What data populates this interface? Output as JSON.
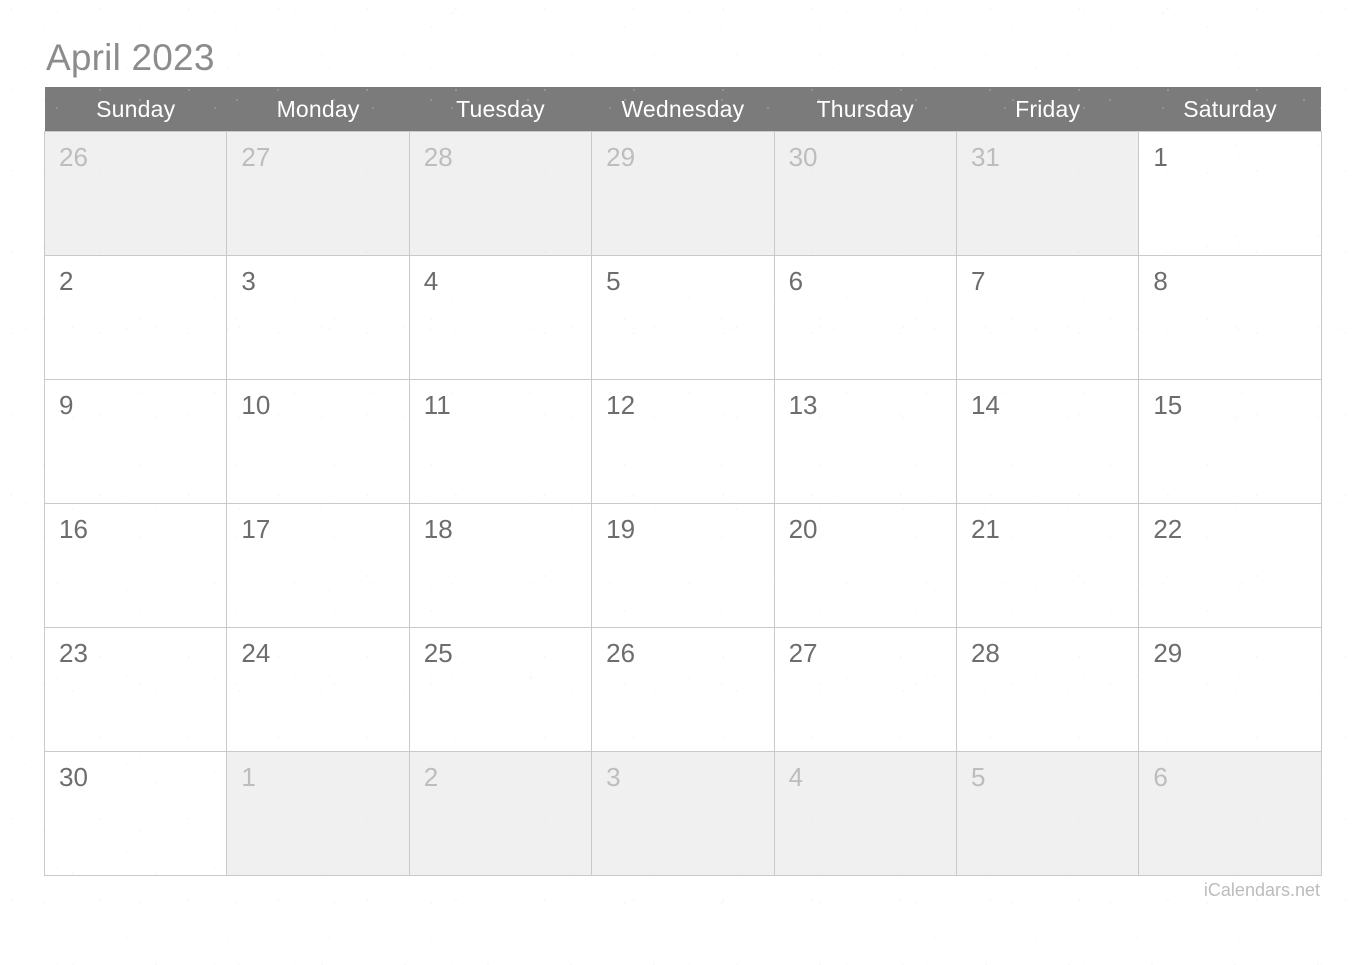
{
  "title": "April 2023",
  "weekday_headers": [
    "Sunday",
    "Monday",
    "Tuesday",
    "Wednesday",
    "Thursday",
    "Friday",
    "Saturday"
  ],
  "watermark": "iCalendars.net",
  "colors": {
    "header_bar": "#7b7b7b",
    "header_text": "#ffffff",
    "title_text": "#8c8c8c",
    "cell_border": "#c9c9c9",
    "cell_background": "#ffffff",
    "padding_cell_background": "#f0f0f0",
    "day_number": "#6d6d6d",
    "padding_day_number": "#bdbdbd",
    "watermark_text": "#bcbcbc"
  },
  "weeks": [
    [
      {
        "day": "26",
        "in_month": false
      },
      {
        "day": "27",
        "in_month": false
      },
      {
        "day": "28",
        "in_month": false
      },
      {
        "day": "29",
        "in_month": false
      },
      {
        "day": "30",
        "in_month": false
      },
      {
        "day": "31",
        "in_month": false
      },
      {
        "day": "1",
        "in_month": true
      }
    ],
    [
      {
        "day": "2",
        "in_month": true
      },
      {
        "day": "3",
        "in_month": true
      },
      {
        "day": "4",
        "in_month": true
      },
      {
        "day": "5",
        "in_month": true
      },
      {
        "day": "6",
        "in_month": true
      },
      {
        "day": "7",
        "in_month": true
      },
      {
        "day": "8",
        "in_month": true
      }
    ],
    [
      {
        "day": "9",
        "in_month": true
      },
      {
        "day": "10",
        "in_month": true
      },
      {
        "day": "11",
        "in_month": true
      },
      {
        "day": "12",
        "in_month": true
      },
      {
        "day": "13",
        "in_month": true
      },
      {
        "day": "14",
        "in_month": true
      },
      {
        "day": "15",
        "in_month": true
      }
    ],
    [
      {
        "day": "16",
        "in_month": true
      },
      {
        "day": "17",
        "in_month": true
      },
      {
        "day": "18",
        "in_month": true
      },
      {
        "day": "19",
        "in_month": true
      },
      {
        "day": "20",
        "in_month": true
      },
      {
        "day": "21",
        "in_month": true
      },
      {
        "day": "22",
        "in_month": true
      }
    ],
    [
      {
        "day": "23",
        "in_month": true
      },
      {
        "day": "24",
        "in_month": true
      },
      {
        "day": "25",
        "in_month": true
      },
      {
        "day": "26",
        "in_month": true
      },
      {
        "day": "27",
        "in_month": true
      },
      {
        "day": "28",
        "in_month": true
      },
      {
        "day": "29",
        "in_month": true
      }
    ],
    [
      {
        "day": "30",
        "in_month": true
      },
      {
        "day": "1",
        "in_month": false
      },
      {
        "day": "2",
        "in_month": false
      },
      {
        "day": "3",
        "in_month": false
      },
      {
        "day": "4",
        "in_month": false
      },
      {
        "day": "5",
        "in_month": false
      },
      {
        "day": "6",
        "in_month": false
      }
    ]
  ]
}
